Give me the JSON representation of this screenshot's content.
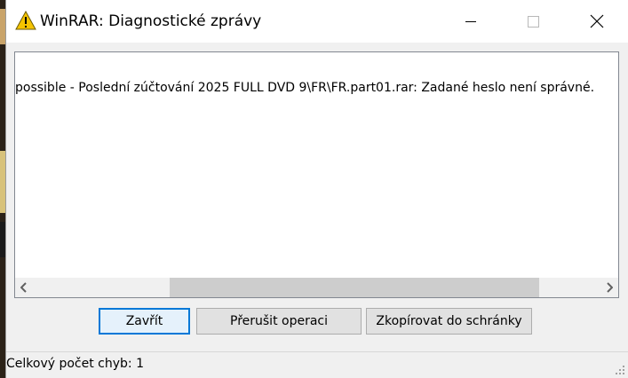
{
  "window": {
    "title": "WinRAR: Diagnostické zprávy"
  },
  "log": {
    "lines": [
      "possible - Poslední zúčtování 2025 FULL DVD 9\\FR\\FR.part01.rar: Zadané heslo není správné."
    ]
  },
  "buttons": {
    "close_label": "Zavřít",
    "abort_label": "Přerušit operaci",
    "copy_label": "Zkopírovat do schránky"
  },
  "status": {
    "text": "Celkový počet chyb: 1"
  },
  "icons": {
    "title": "warning-icon",
    "minimize": "minimize-icon",
    "maximize": "maximize-icon",
    "close": "close-icon",
    "scroll_left": "chevron-left-icon",
    "scroll_right": "chevron-right-icon",
    "grip": "resize-grip-icon"
  },
  "colors": {
    "accent": "#0078d7",
    "warning": "#f5c400"
  }
}
